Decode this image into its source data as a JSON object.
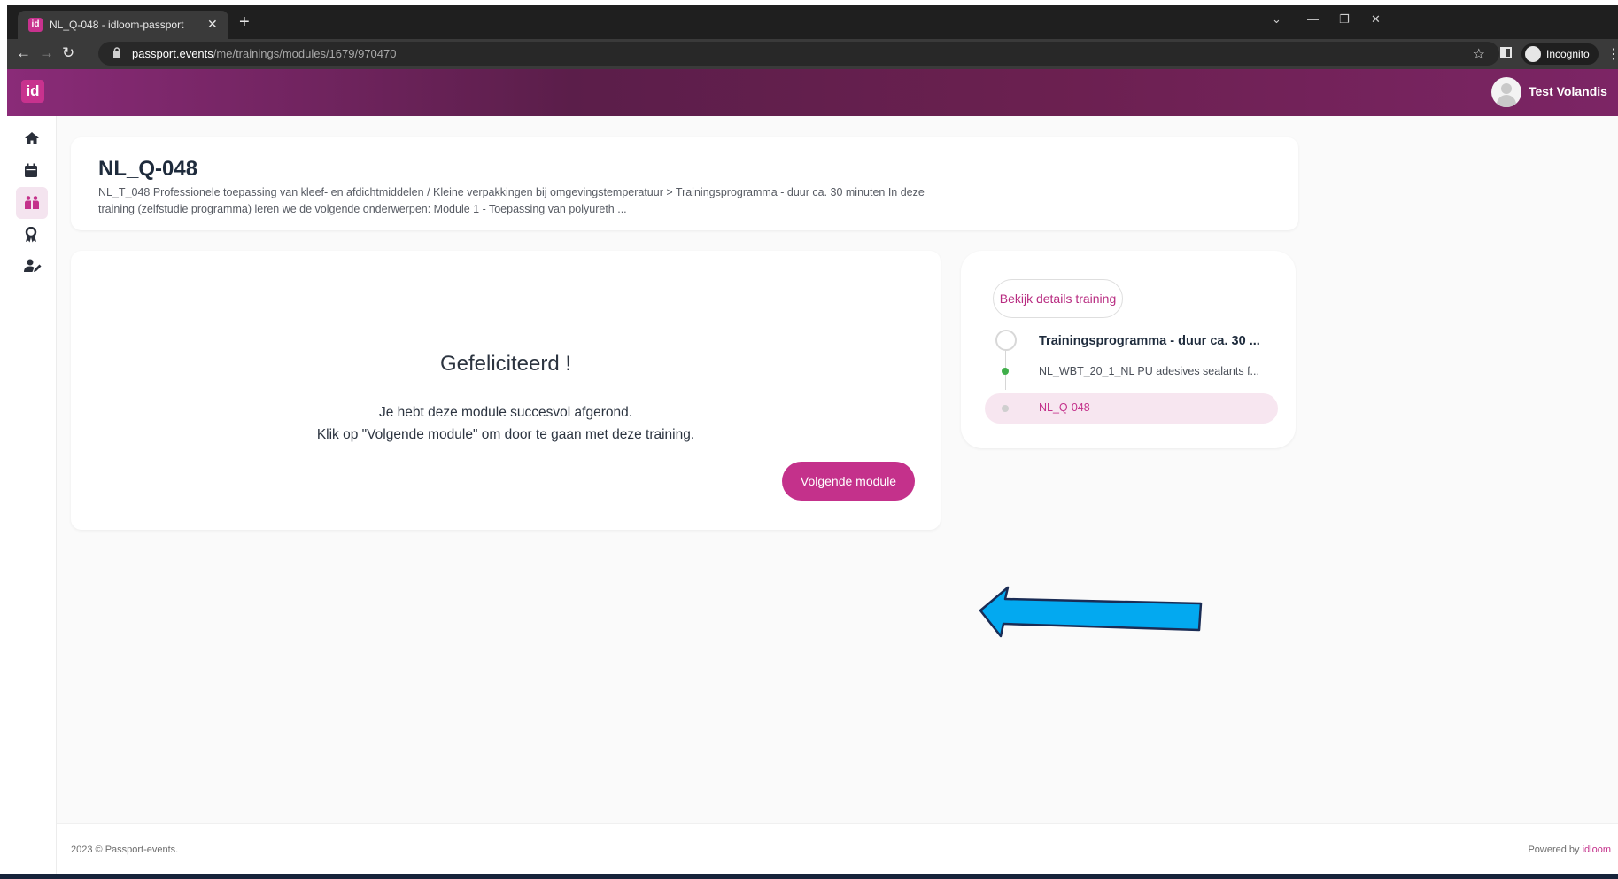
{
  "browser": {
    "tab_title": "NL_Q-048 - idloom-passport",
    "favicon_text": "id",
    "url_host": "passport.events",
    "url_path": "/me/trainings/modules/1679/970470",
    "incognito_label": "Incognito"
  },
  "app": {
    "logo_text": "id",
    "user_name": "Test Volandis",
    "brand_color": "#c4318b"
  },
  "sidebar": {
    "items": [
      {
        "icon": "home-icon",
        "active": false
      },
      {
        "icon": "calendar-icon",
        "active": false
      },
      {
        "icon": "training-icon",
        "active": true
      },
      {
        "icon": "award-icon",
        "active": false
      },
      {
        "icon": "user-edit-icon",
        "active": false
      }
    ]
  },
  "page": {
    "title": "NL_Q-048",
    "description": "NL_T_048 Professionele toepassing van kleef- en afdichtmiddelen / Kleine verpakkingen bij omgevingstemperatuur > Trainingsprogramma - duur ca. 30 minuten In deze training (zelfstudie programma) leren we de volgende onderwerpen: Module 1 - Toepassing van polyureth ..."
  },
  "module": {
    "heading": "Gefeliciteerd !",
    "line1": "Je hebt deze module succesvol afgerond.",
    "line2": "Klik op \"Volgende module\" om door te gaan met deze training.",
    "next_button": "Volgende module"
  },
  "progress": {
    "details_button": "Bekijk details training",
    "program_title": "Trainingsprogramma - duur ca. 30 ...",
    "items": [
      {
        "label": "NL_WBT_20_1_NL PU adesives sealants f...",
        "status": "completed",
        "dot_color": "#3fae49"
      },
      {
        "label": "NL_Q-048",
        "status": "current",
        "dot_color": "#cfcfcf"
      }
    ]
  },
  "footer": {
    "copyright": "2023 © Passport-events.",
    "powered_by": "Powered by",
    "powered_brand": "idloom"
  },
  "annotation": {
    "arrow_color": "#03a9f0"
  }
}
